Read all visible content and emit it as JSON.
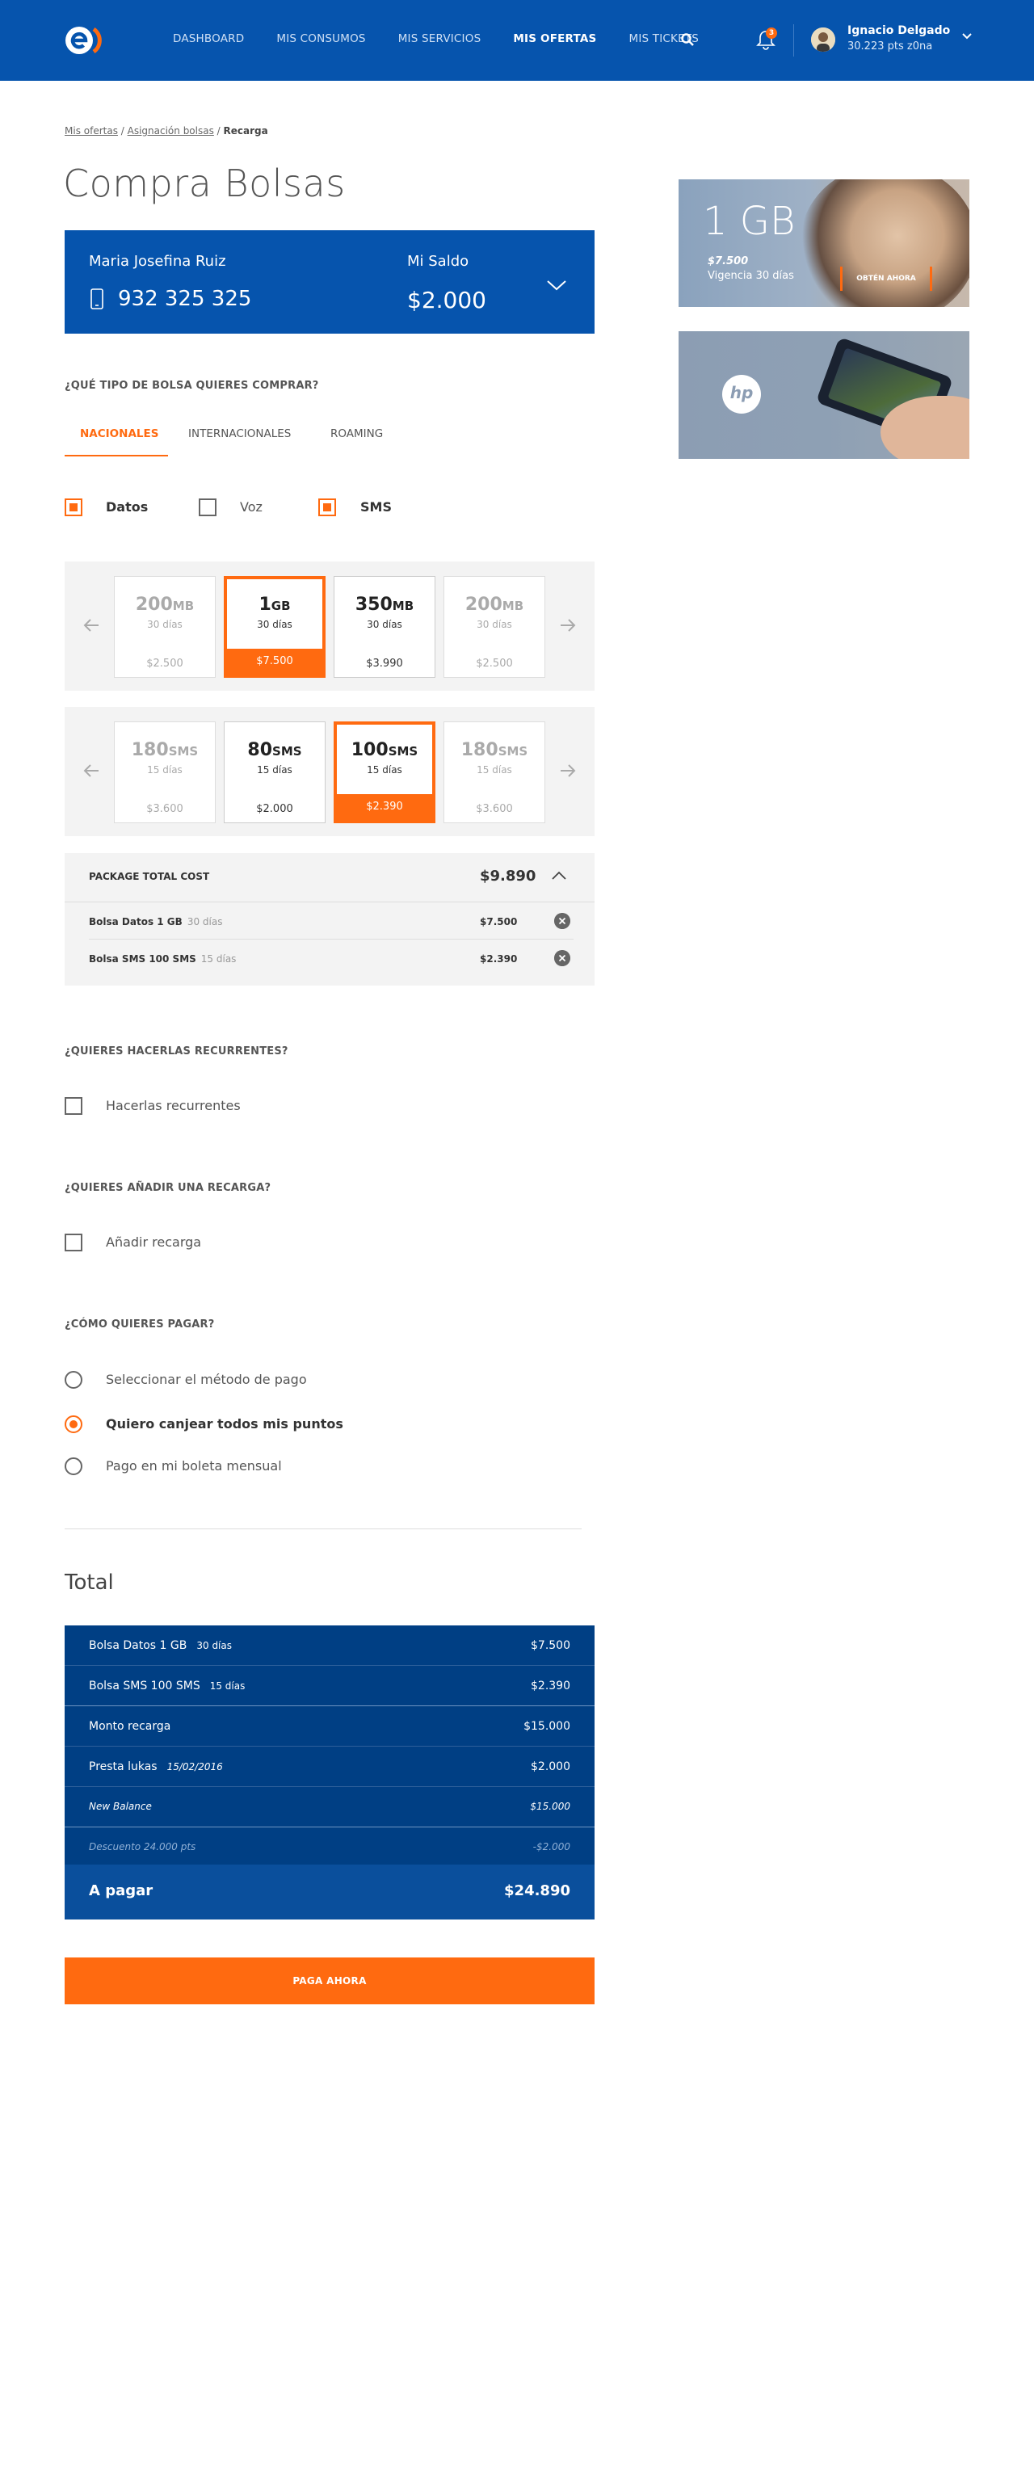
{
  "header": {
    "nav": [
      {
        "label": "DASHBOARD",
        "active": false
      },
      {
        "label": "MIS CONSUMOS",
        "active": false
      },
      {
        "label": "MIS SERVICIOS",
        "active": false
      },
      {
        "label": "MIS OFERTAS",
        "active": true
      },
      {
        "label": "MIS TICKETS",
        "active": false
      }
    ],
    "notifications": "3",
    "user": {
      "name": "Ignacio Delgado",
      "points": "30.223 pts z0na"
    }
  },
  "breadcrumb": {
    "items": [
      "Mis ofertas",
      "Asignación bolsas"
    ],
    "current": "Recarga"
  },
  "page_title": "Compra Bolsas",
  "account": {
    "name": "Maria Josefina Ruiz",
    "phone": "932 325 325",
    "saldo_label": "Mi Saldo",
    "saldo": "$2.000"
  },
  "bag_type": {
    "question": "¿QUÉ TIPO DE BOLSA QUIERES COMPRAR?",
    "tabs": [
      "NACIONALES",
      "INTERNACIONALES",
      "ROAMING"
    ],
    "filters": [
      {
        "label": "Datos",
        "checked": true
      },
      {
        "label": "Voz",
        "checked": false
      },
      {
        "label": "SMS",
        "checked": true
      }
    ]
  },
  "data_cards": [
    {
      "amount": "200",
      "unit": "MB",
      "duration": "30 días",
      "price": "$2.500",
      "state": "dim"
    },
    {
      "amount": "1",
      "unit": "GB",
      "duration": "30 días",
      "price": "$7.500",
      "state": "selected"
    },
    {
      "amount": "350",
      "unit": "MB",
      "duration": "30 días",
      "price": "$3.990",
      "state": "normal"
    },
    {
      "amount": "200",
      "unit": "MB",
      "duration": "30 días",
      "price": "$2.500",
      "state": "dim"
    }
  ],
  "sms_cards": [
    {
      "amount": "180",
      "unit": "SMS",
      "duration": "15 días",
      "price": "$3.600",
      "state": "dim"
    },
    {
      "amount": "80",
      "unit": "SMS",
      "duration": "15 días",
      "price": "$2.000",
      "state": "normal"
    },
    {
      "amount": "100",
      "unit": "SMS",
      "duration": "15 días",
      "price": "$2.390",
      "state": "selected"
    },
    {
      "amount": "180",
      "unit": "SMS",
      "duration": "15 días",
      "price": "$3.600",
      "state": "dim"
    }
  ],
  "package": {
    "label": "PACKAGE TOTAL COST",
    "total": "$9.890",
    "items": [
      {
        "name": "Bolsa Datos 1 GB",
        "duration": "30 días",
        "price": "$7.500"
      },
      {
        "name": "Bolsa SMS 100 SMS",
        "duration": "15 días",
        "price": "$2.390"
      }
    ]
  },
  "recurrent": {
    "question": "¿QUIERES HACERLAS RECURRENTES?",
    "option": "Hacerlas recurrentes",
    "checked": false
  },
  "recharge": {
    "question": "¿QUIERES AÑADIR UNA RECARGA?",
    "option": "Añadir recarga",
    "checked": false
  },
  "payment": {
    "question": "¿CÓMO QUIERES PAGAR?",
    "options": [
      {
        "label": "Seleccionar el método de pago",
        "selected": false
      },
      {
        "label": "Quiero canjear todos mis puntos",
        "selected": true
      },
      {
        "label": "Pago en mi boleta mensual",
        "selected": false
      }
    ]
  },
  "total": {
    "title": "Total",
    "rows": [
      {
        "label": "Bolsa Datos 1 GB",
        "sub": "30 días",
        "value": "$7.500"
      },
      {
        "label": "Bolsa SMS 100 SMS",
        "sub": "15 días",
        "value": "$2.390"
      },
      {
        "label": "Monto recarga",
        "sub": "",
        "value": "$15.000"
      },
      {
        "label": "Presta lukas",
        "sub": "15/02/2016",
        "value": "$2.000"
      },
      {
        "label": "New Balance",
        "sub": "",
        "value": "$15.000"
      },
      {
        "label": "Descuento 24.000 pts",
        "sub": "",
        "value": "-$2.000"
      }
    ],
    "pay_label": "A pagar",
    "pay_value": "$24.890"
  },
  "pay_button": "PAGA AHORA",
  "banners": {
    "promo": {
      "amount": "1 GB",
      "price": "$7.500",
      "validity": "Vigencia 30 días",
      "cta": "OBTÉN AHORA"
    },
    "hp_logo": "hp"
  },
  "colors": {
    "brand_blue": "#0654ad",
    "dark_blue": "#003f84",
    "accent_orange": "#ff6a10"
  }
}
